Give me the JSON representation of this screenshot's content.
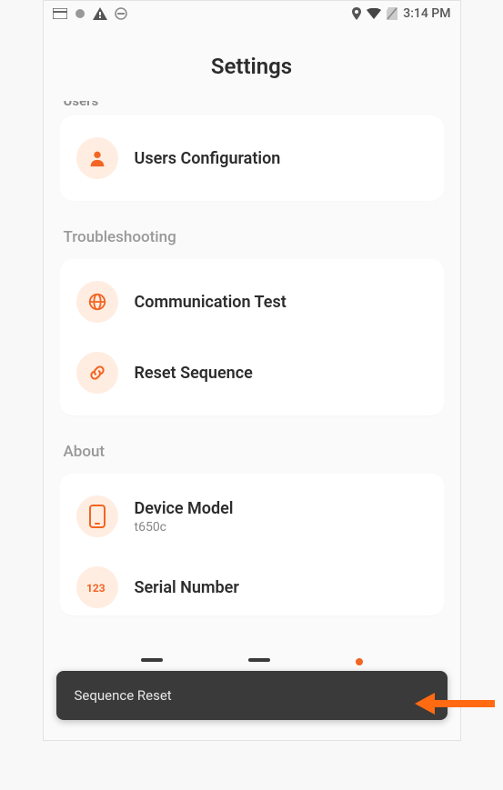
{
  "status": {
    "time": "3:14 PM"
  },
  "header": {
    "title": "Settings"
  },
  "cut_section_label": "Users",
  "sections": {
    "users": {
      "items": [
        {
          "title": "Users Configuration"
        }
      ]
    },
    "troubleshooting": {
      "label": "Troubleshooting",
      "items": [
        {
          "title": "Communication Test"
        },
        {
          "title": "Reset Sequence"
        }
      ]
    },
    "about": {
      "label": "About",
      "items": [
        {
          "title": "Device Model",
          "sub": "t650c"
        },
        {
          "title": "Serial Number"
        }
      ]
    }
  },
  "toast": {
    "text": "Sequence Reset"
  }
}
